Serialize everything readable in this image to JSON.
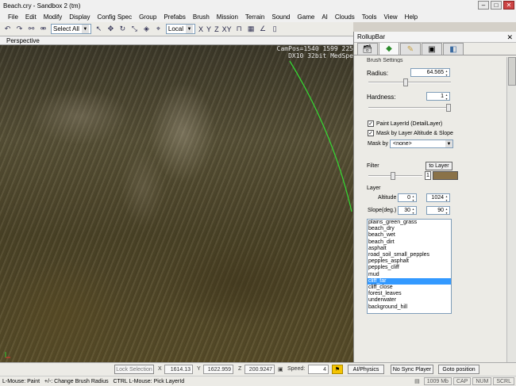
{
  "title": "Beach.cry - Sandbox 2 (tm)",
  "menu": [
    "File",
    "Edit",
    "Modify",
    "Display",
    "Config Spec",
    "Group",
    "Prefabs",
    "Brush",
    "Mission",
    "Terrain",
    "Sound",
    "Game",
    "AI",
    "Clouds",
    "Tools",
    "View",
    "Help"
  ],
  "toolbar": {
    "select_mode": "Select All",
    "coord_system": "Local",
    "axes": [
      "X",
      "Y",
      "Z",
      "XY"
    ]
  },
  "viewport": {
    "label": "Perspective",
    "campos_line1": "CamPos=1540 1599 225",
    "campos_line2": "DX10 32bit MedSpe"
  },
  "status": {
    "lock_selection": "Lock Selection",
    "x_label": "X",
    "x_value": "1614.13",
    "y_label": "Y",
    "y_value": "1622.959",
    "z_label": "Z",
    "z_value": "200.9247",
    "speed_label": "Speed:",
    "speed_value": "4",
    "ai_physics": "AI/Physics",
    "sync_player": "No Sync Player",
    "goto_position": "Goto position",
    "hint": "L-Mouse: Paint   +/-: Change Brush Radius   CTRL L-Mouse: Pick LayerId",
    "memory": "1009 Mb",
    "cap": "CAP",
    "num": "NUM",
    "scrl": "SCRL"
  },
  "rollup": {
    "title": "RollupBar",
    "section_title": "Brush Settings",
    "radius_label": "Radius:",
    "radius_value": "64.565",
    "radius_slider": 0.45,
    "hardness_label": "Hardness:",
    "hardness_value": "1",
    "hardness_slider": 1.0,
    "paint_layer_label": "Paint LayerId (DetailLayer)",
    "paint_layer_checked": true,
    "mask_altitude_label": "Mask by Layer Altitude & Slope",
    "mask_altitude_checked": true,
    "mask_by_label": "Mask by",
    "mask_by_value": "<none>",
    "filter_label": "Filter",
    "to_layer_button": "to Layer",
    "filter_value": "1",
    "filter_color": "#8a7248",
    "layer_label": "Layer",
    "altitude_label": "Altitude",
    "altitude_min": "0",
    "altitude_max": "1024",
    "slope_label": "Slope(deg.)",
    "slope_min": "30",
    "slope_max": "90",
    "layers": [
      "plains_green_grass",
      "beach_dry",
      "beach_wet",
      "beach_dirt",
      "asphalt",
      "road_soil_small_pepples",
      "pepples_asphalt",
      "pepples_cliff",
      "mud",
      "cliff_far",
      "cliff_close",
      "forest_leaves",
      "underwater",
      "background_hill"
    ],
    "selected_layer": "cliff_far"
  }
}
